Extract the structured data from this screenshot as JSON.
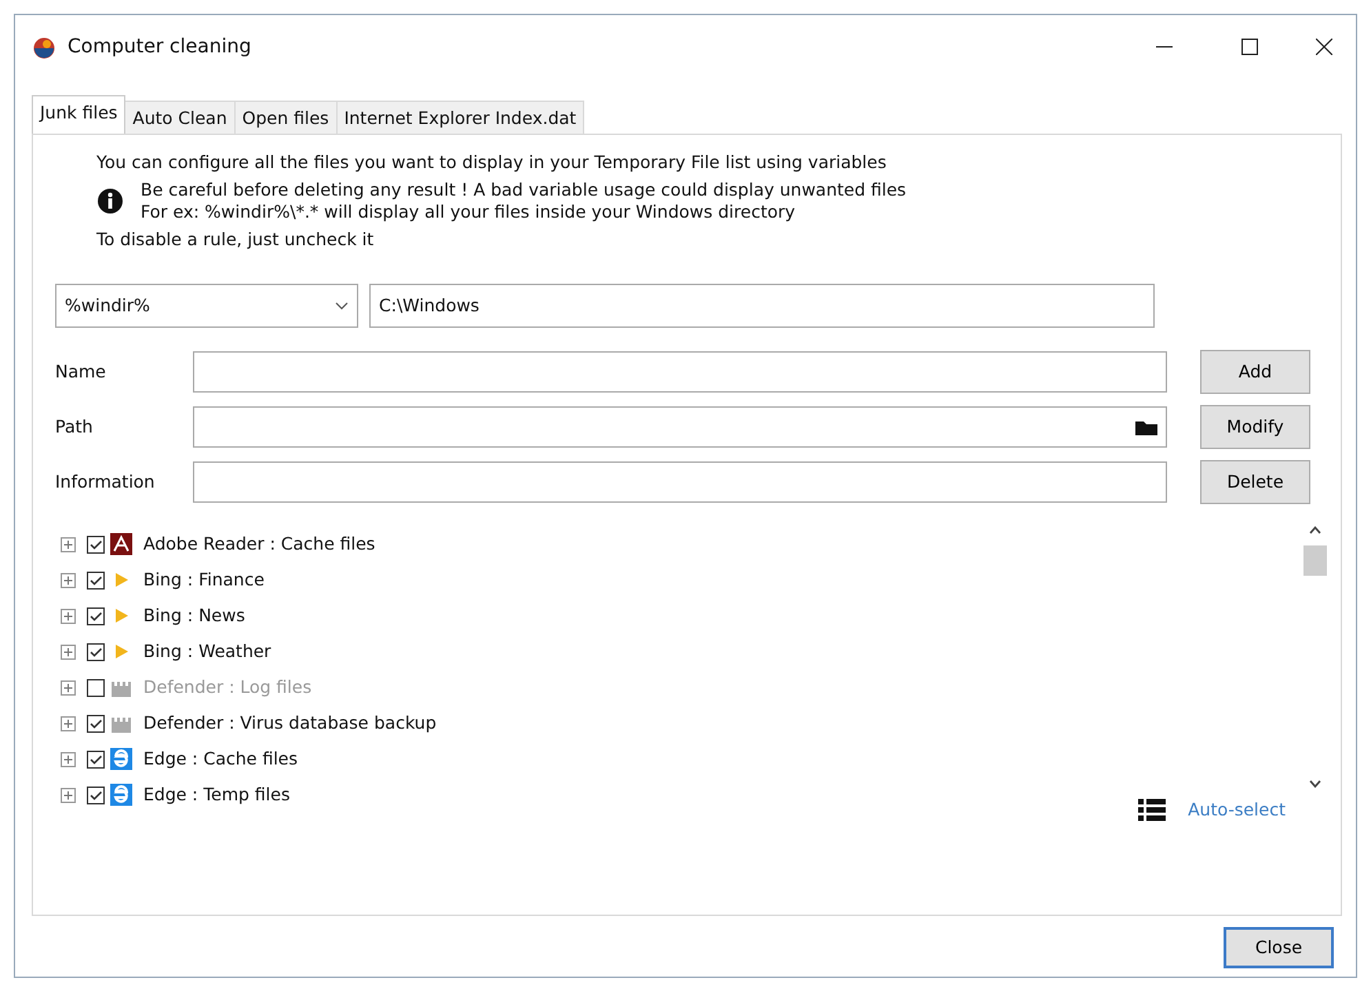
{
  "window": {
    "title": "Computer cleaning"
  },
  "tabs": [
    {
      "label": "Junk files",
      "selected": true
    },
    {
      "label": "Auto Clean",
      "selected": false
    },
    {
      "label": "Open files",
      "selected": false
    },
    {
      "label": "Internet Explorer Index.dat",
      "selected": false
    }
  ],
  "intro": "You can configure all the files you want to display in your Temporary File list using variables",
  "warning": [
    "Be careful before deleting any result ! A bad variable usage could display unwanted files",
    "For ex: %windir%\\*.* will display all your files inside your Windows directory"
  ],
  "hint": "To disable a rule, just uncheck it",
  "variable": {
    "selected": "%windir%",
    "value": "C:\\Windows"
  },
  "fields": [
    {
      "label": "Name",
      "kind": "text"
    },
    {
      "label": "Path",
      "kind": "folder"
    },
    {
      "label": "Information",
      "kind": "text"
    }
  ],
  "buttons": [
    "Add",
    "Modify",
    "Delete"
  ],
  "rules": [
    {
      "label": "Adobe Reader : Cache files",
      "checked": true,
      "kind": "adobe"
    },
    {
      "label": "Bing : Finance",
      "checked": true,
      "kind": "bing"
    },
    {
      "label": "Bing : News",
      "checked": true,
      "kind": "bing"
    },
    {
      "label": "Bing : Weather",
      "checked": true,
      "kind": "bing"
    },
    {
      "label": "Defender : Log files",
      "checked": false,
      "kind": "defender"
    },
    {
      "label": "Defender : Virus database backup",
      "checked": true,
      "kind": "defender"
    },
    {
      "label": "Edge : Cache files",
      "checked": true,
      "kind": "edge"
    },
    {
      "label": "Edge : Temp files",
      "checked": true,
      "kind": "edge"
    }
  ],
  "auto_select": "Auto-select",
  "close_button": "Close"
}
